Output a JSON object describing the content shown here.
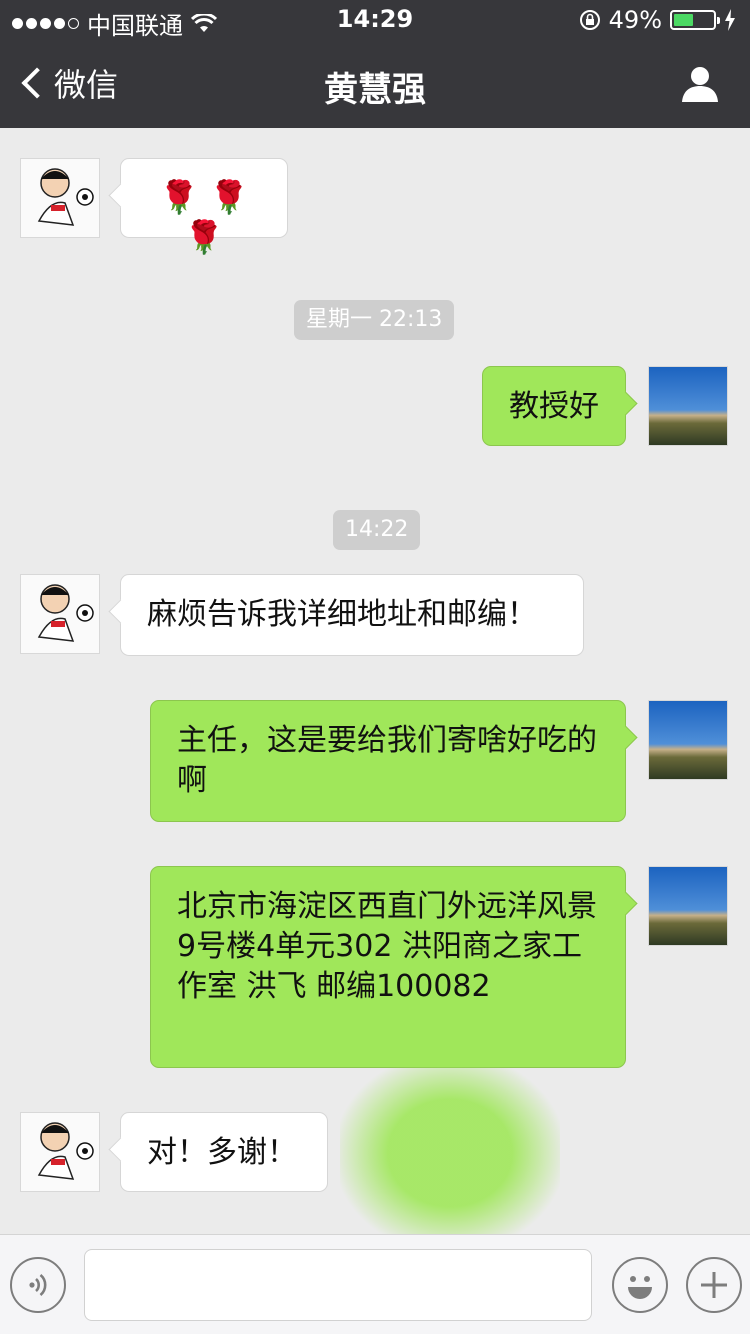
{
  "status_bar": {
    "carrier": "中国联通",
    "time": "14:29",
    "battery_percent": "49%",
    "battery_level": 0.49
  },
  "nav": {
    "back_label": "微信",
    "title": "黄慧强"
  },
  "messages": [
    {
      "type": "in",
      "text": "🌹 🌹 🌹"
    },
    {
      "type": "time",
      "text": "星期一 22:13"
    },
    {
      "type": "out",
      "text": "教授好"
    },
    {
      "type": "time",
      "text": "14:22"
    },
    {
      "type": "in",
      "text": "麻烦告诉我详细地址和邮编！"
    },
    {
      "type": "out",
      "text": "主任，这是要给我们寄啥好吃的啊"
    },
    {
      "type": "out",
      "text": "北京市海淀区西直门外远洋风景9号楼4单元302 洪阳商之家工作室 洪飞 邮编100082"
    },
    {
      "type": "in",
      "text": "对！多谢！"
    }
  ],
  "colors": {
    "nav_bg": "#37373b",
    "chat_bg": "#ebebeb",
    "bubble_out": "#a0e75a",
    "bubble_in": "#ffffff",
    "battery_green": "#4cd964"
  }
}
